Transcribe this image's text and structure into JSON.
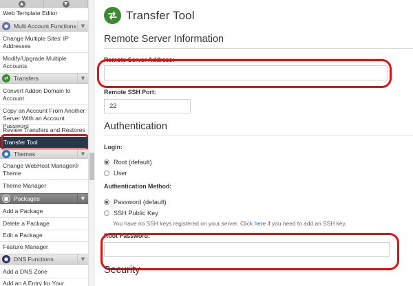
{
  "sidebar": {
    "scroll_up_icon": "chevron-up-icon",
    "scroll_down_icon": "chevron-down-icon",
    "items_top": [
      {
        "label": "Web Template Editor"
      }
    ],
    "section_multi": {
      "label": "Multi Account Functions",
      "icon": "people-icon",
      "icon_color": "#6b6bb0"
    },
    "items_multi": [
      {
        "label": "Change Multiple Sites' IP Addresses"
      },
      {
        "label": "Modify/Upgrade Multiple Accounts"
      }
    ],
    "section_transfers": {
      "label": "Transfers",
      "icon": "transfer-icon",
      "icon_color": "#3b8a2f"
    },
    "items_transfers": [
      {
        "label": "Convert Addon Domain to Account"
      },
      {
        "label": "Copy an Account From Another Server With an Account Password"
      },
      {
        "label": "Review Transfers and Restores"
      },
      {
        "label": "Transfer Tool"
      }
    ],
    "section_themes": {
      "label": "Themes",
      "icon": "palette-icon",
      "icon_color": "#2a74b8"
    },
    "items_themes": [
      {
        "label": "Change WebHost Manager® Theme"
      },
      {
        "label": "Theme Manager"
      }
    ],
    "section_packages": {
      "label": "Packages",
      "icon": "package-icon",
      "icon_color": "#8a8a8a"
    },
    "items_packages": [
      {
        "label": "Add a Package"
      },
      {
        "label": "Delete a Package"
      },
      {
        "label": "Edit a Package"
      },
      {
        "label": "Feature Manager"
      }
    ],
    "section_dns": {
      "label": "DNS Functions",
      "icon": "dns-icon",
      "icon_color": "#333366"
    },
    "items_dns": [
      {
        "label": "Add a DNS Zone"
      },
      {
        "label": "Add an A Entry for Your"
      }
    ]
  },
  "main": {
    "title": "Transfer Tool",
    "title_icon": "transfer-tool-icon",
    "remote_section": "Remote Server Information",
    "remote_address_label": "Remote Server Address:",
    "remote_address_value": "",
    "ssh_port_label": "Remote SSH Port:",
    "ssh_port_value": "22",
    "auth_section": "Authentication",
    "login_label": "Login:",
    "login_options": [
      {
        "label": "Root (default)",
        "checked": true
      },
      {
        "label": "User",
        "checked": false
      }
    ],
    "auth_method_label": "Authentication Method:",
    "auth_method_options": [
      {
        "label": "Password (default)",
        "checked": true
      },
      {
        "label": "SSH Public Key",
        "checked": false
      }
    ],
    "ssh_help_prefix": "You have no SSH keys registered on your server. Click ",
    "ssh_help_link": "here",
    "ssh_help_suffix": " if you need to add an SSH key.",
    "root_password_label": "Root Password:",
    "root_password_value": "",
    "security_section": "Security"
  },
  "colors": {
    "highlight_red": "#dd1111",
    "active_nav_bg": "#243848",
    "brand_green": "#3b8a2f",
    "link_blue": "#2a6ebb"
  }
}
